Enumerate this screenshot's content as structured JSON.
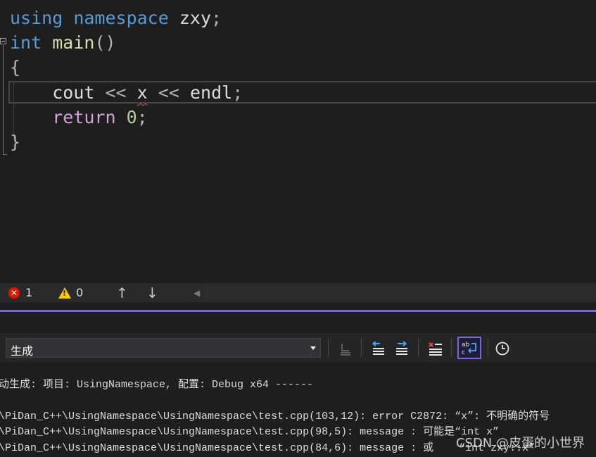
{
  "editor": {
    "line1": {
      "kw_using": "using",
      "kw_namespace": "namespace",
      "name": "zxy",
      "semi": ";"
    },
    "line2": {
      "kw_int": "int",
      "fn": "main",
      "parens": "()"
    },
    "line3": {
      "brace_open": "{"
    },
    "line4": {
      "cout": "cout",
      "op1": "<<",
      "x": "x",
      "op2": "<<",
      "endl": "endl",
      "semi": ";"
    },
    "line5": {
      "kw_return": "return",
      "num": "0",
      "semi": ";"
    },
    "line6": {
      "brace_close": "}"
    }
  },
  "status_strip": {
    "error_count": "1",
    "warning_count": "0",
    "error_icon": "error-icon",
    "warning_icon": "warning-icon",
    "up_arrow": "↑",
    "down_arrow": "↓",
    "scroll_left": "◀"
  },
  "output": {
    "source_selected": "生成",
    "toolbar_icons": [
      "goto-error-icon",
      "prev-message-icon",
      "next-message-icon",
      "clear-all-icon",
      "word-wrap-icon",
      "history-icon"
    ],
    "lines": [
      "动生成: 项目: UsingNamespace, 配置: Debug x64 ------",
      "",
      "\\PiDan_C++\\UsingNamespace\\UsingNamespace\\test.cpp(103,12): error C2872: “x”: 不明确的符号",
      "\\PiDan_C++\\UsingNamespace\\UsingNamespace\\test.cpp(98,5): message : 可能是“int x”",
      "\\PiDan_C++\\UsingNamespace\\UsingNamespace\\test.cpp(84,6): message : 或    “int zxy::x”"
    ]
  },
  "watermark": "CSDN @皮蛋的小世界",
  "colors": {
    "keyword": "#569cd6",
    "function": "#dcdcaa",
    "control": "#d8a0df",
    "number": "#b5cea8",
    "accent": "#7c66d6",
    "error": "#e51400",
    "warning": "#ffcc00"
  }
}
